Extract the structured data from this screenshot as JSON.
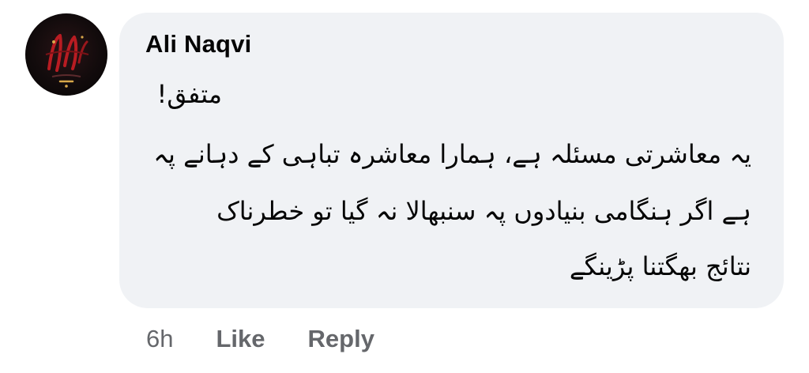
{
  "comment": {
    "author": "Ali Naqvi",
    "lines": [
      "متفق!",
      "یہ معاشرتی مسئلہ ہے، ہمارا معاشرہ تباہی کے دہانے پہ",
      "ہے اگر ہنگامی بنیادوں پہ سنبھالا نہ گیا تو خطرناک",
      "نتائج بھگتنا پڑینگے"
    ],
    "timestamp": "6h",
    "like_label": "Like",
    "reply_label": "Reply"
  },
  "avatar": {
    "icon": "profile-picture",
    "colors": {
      "background": "#120b0c",
      "accent_red": "#b81c22",
      "accent_gold": "#d8a84a"
    }
  },
  "colors": {
    "bubble": "#f0f2f5",
    "text": "#050505",
    "meta": "#65676b"
  }
}
